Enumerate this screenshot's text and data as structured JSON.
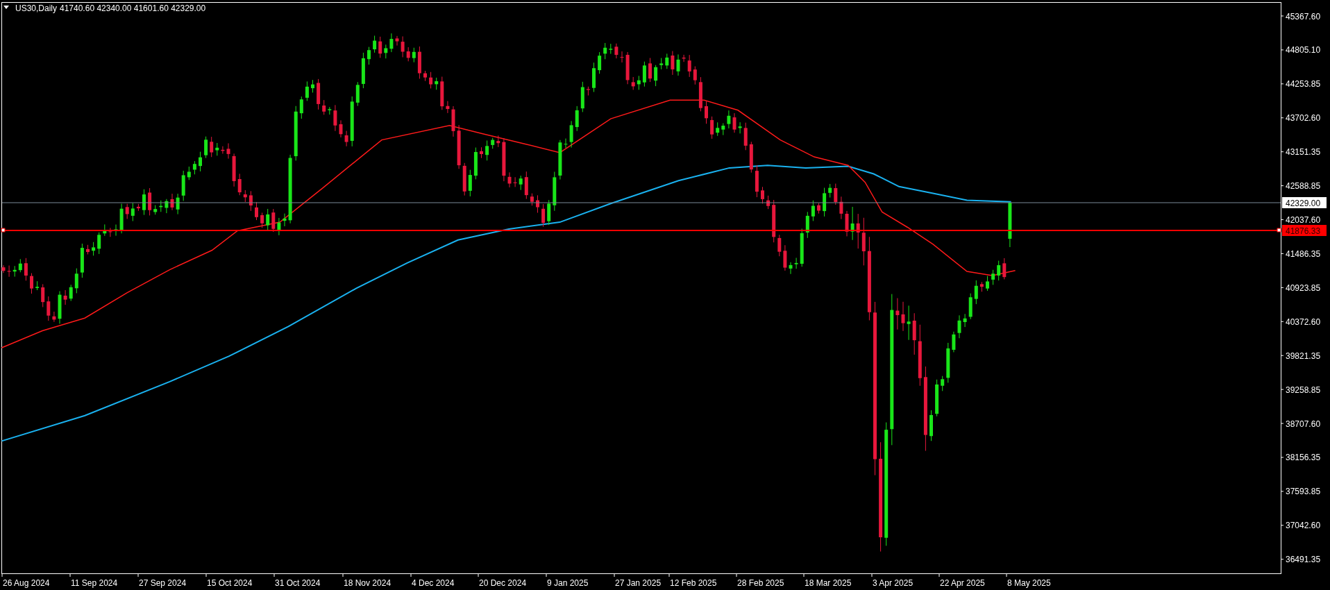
{
  "header": {
    "symbol": "US30,Daily",
    "ohlc": "41740.60 42340.00 41601.60 42329.00"
  },
  "price_axis": {
    "labels": [
      "45367.60",
      "44805.10",
      "44253.85",
      "43702.60",
      "43151.35",
      "42588.85",
      "42037.60",
      "41486.35",
      "40923.85",
      "40372.60",
      "39821.35",
      "39258.85",
      "38707.60",
      "38156.35",
      "37593.85",
      "37042.60",
      "36491.35"
    ]
  },
  "current_price": {
    "label": "42329.00"
  },
  "level_line": {
    "label": "41876.33"
  },
  "time_axis": {
    "labels": [
      "26 Aug 2024",
      "11 Sep 2024",
      "27 Sep 2024",
      "15 Oct 2024",
      "31 Oct 2024",
      "18 Nov 2024",
      "4 Dec 2024",
      "20 Dec 2024",
      "9 Jan 2025",
      "27 Jan 2025",
      "12 Feb 2025",
      "28 Feb 2025",
      "18 Mar 2025",
      "3 Apr 2025",
      "22 Apr 2025",
      "8 May 2025"
    ]
  }
}
